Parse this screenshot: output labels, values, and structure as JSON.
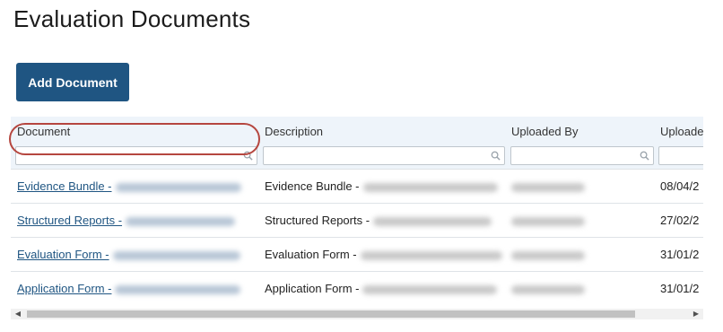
{
  "page": {
    "title": "Evaluation Documents"
  },
  "toolbar": {
    "add_label": "Add Document"
  },
  "grid": {
    "columns": [
      {
        "key": "document",
        "label": "Document"
      },
      {
        "key": "description",
        "label": "Description"
      },
      {
        "key": "uploaded_by",
        "label": "Uploaded By"
      },
      {
        "key": "uploaded_on",
        "label": "Uploade"
      }
    ],
    "rows": [
      {
        "document": "Evidence Bundle -",
        "description": "Evidence Bundle -",
        "uploaded_on": "08/04/2"
      },
      {
        "document": "Structured Reports -",
        "description": "Structured Reports -",
        "uploaded_on": "27/02/2"
      },
      {
        "document": "Evaluation Form -",
        "description": "Evaluation Form -",
        "uploaded_on": "31/01/2"
      },
      {
        "document": "Application Form -",
        "description": "Application Form -",
        "uploaded_on": "31/01/2"
      }
    ],
    "highlighted_row": "Evaluation Form -",
    "scroll": {
      "left_arrow": "◀",
      "right_arrow": "▶"
    }
  },
  "colors": {
    "accent": "#1f5582",
    "header_bg": "#eef4fa",
    "highlight": "#b5463f"
  },
  "icons": {
    "filter": "search-icon"
  }
}
